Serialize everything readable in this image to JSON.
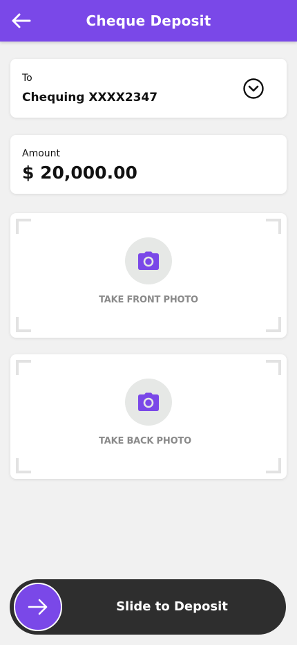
{
  "header": {
    "title": "Cheque Deposit",
    "background_color": "#7a48e8",
    "back_icon": "arrow-left-icon"
  },
  "to_field": {
    "label": "To",
    "value": "Chequing XXXX2347",
    "dropdown_icon": "chevron-down-circle-icon"
  },
  "amount_field": {
    "label": "Amount",
    "value": "$ 20,000.00"
  },
  "front_photo": {
    "label": "TAKE FRONT PHOTO",
    "icon": "camera-icon"
  },
  "back_photo": {
    "label": "TAKE BACK PHOTO",
    "icon": "camera-icon"
  },
  "slider": {
    "label": "Slide to Deposit",
    "icon": "arrow-right-icon",
    "bar_color": "#2e2e2e",
    "knob_color": "#7a48e8"
  }
}
